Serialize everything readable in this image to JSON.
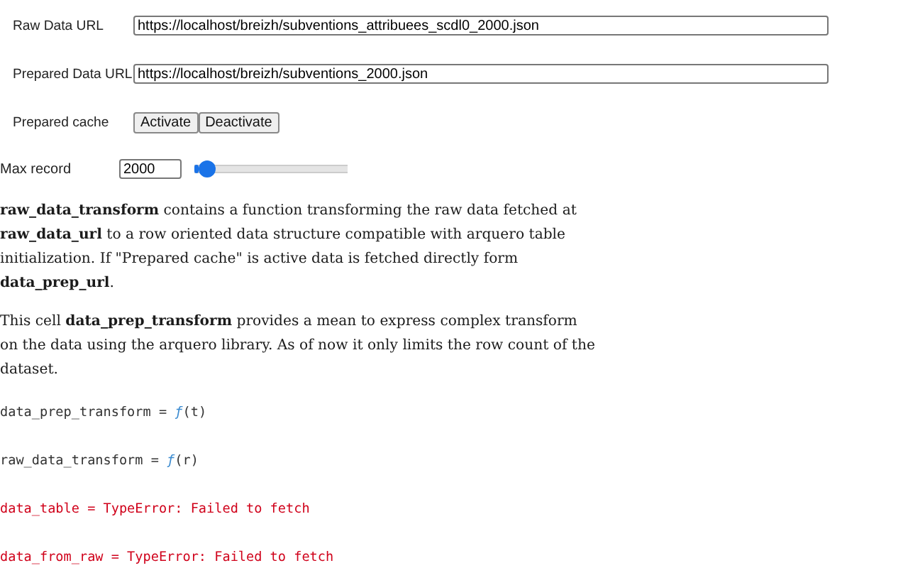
{
  "form": [
    {
      "label": "Raw Data URL",
      "value": "https://localhost/breizh/subventions_attribuees_scdl0_2000.json"
    },
    {
      "label": "Prepared Data URL",
      "value": "https://localhost/breizh/subventions_2000.json"
    }
  ],
  "cache": {
    "label": "Prepared cache",
    "buttons": [
      "Activate",
      "Deactivate"
    ]
  },
  "max_record": {
    "label": "Max record",
    "value": "2000",
    "level": 0.03
  },
  "paragraphs": [
    "**raw_data_transform** contains a function transforming the raw data fetched at **raw_data_url** to a row oriented data structure compatible with arquero table initialization. If \"Prepared cache\" is active data is fetched directly form **data_prep_url**.",
    "This cell **data_prep_transform** provides a mean to express complex transform on the data using the arquero library. As of now it only limits the row count of the dataset."
  ],
  "cells": [
    {
      "kind": "function",
      "name": "data_prep_transform = ",
      "symbol": "ƒ",
      "rest": "(t)"
    },
    {
      "kind": "function",
      "name": "raw_data_transform = ",
      "symbol": "ƒ",
      "rest": "(r)"
    },
    {
      "kind": "error",
      "text": "data_table = TypeError: Failed to fetch"
    },
    {
      "kind": "error",
      "text": "data_from_raw = TypeError: Failed to fetch"
    }
  ]
}
